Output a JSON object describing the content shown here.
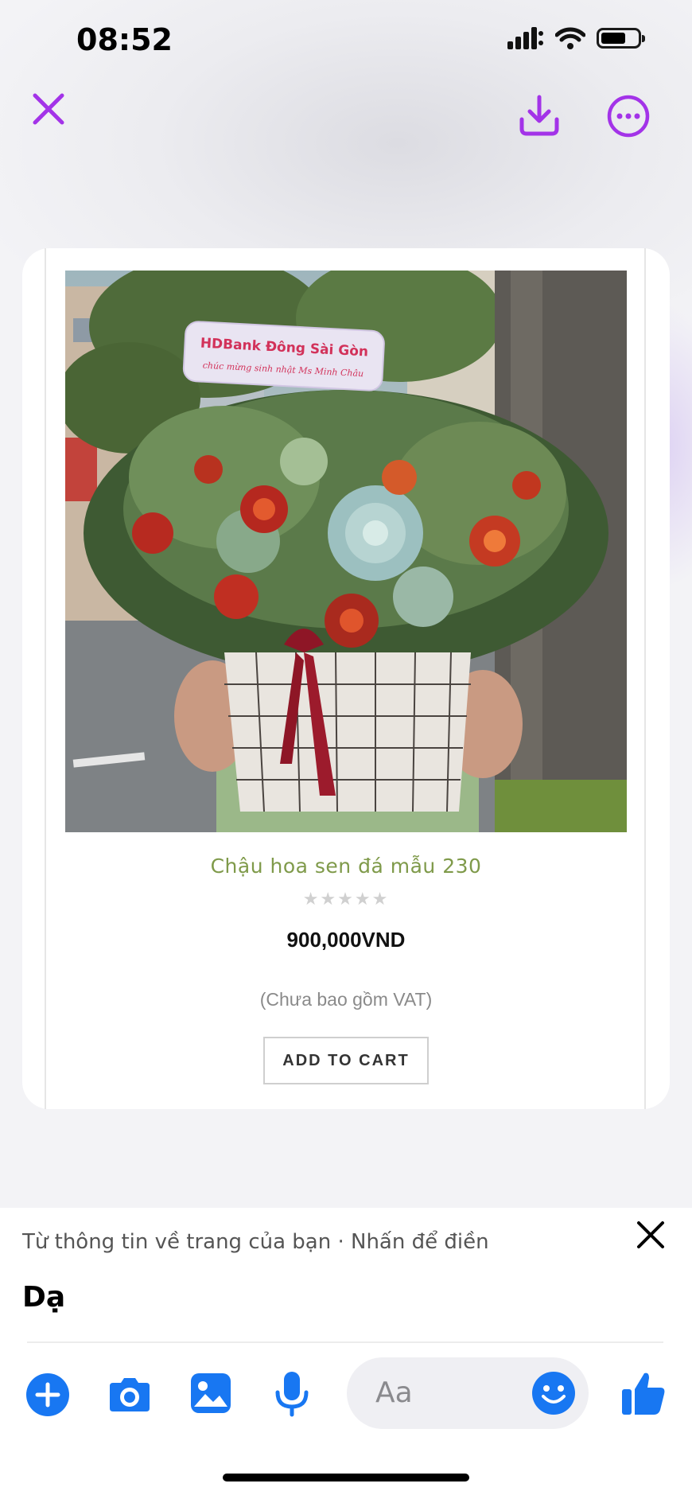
{
  "status_bar": {
    "time": "08:52",
    "icons": [
      "cellular-signal-icon",
      "wifi-icon",
      "battery-icon"
    ]
  },
  "viewer_toolbar": {
    "icons": [
      "close-icon",
      "download-icon",
      "more-options-icon"
    ],
    "accent": "#a333e8"
  },
  "product_card": {
    "name": "Chậu hoa sen đá mẫu 230",
    "rating_stars": 0,
    "stars_display": "★★★★★",
    "price": "900,000VND",
    "vat_note": "(Chưa bao gồm VAT)",
    "cart_button": "ADD TO CART",
    "sign_line1": "HDBank Đông Sài Gòn",
    "sign_line2": "chúc mừng sinh nhật Ms Minh Châu",
    "name_color": "#7f9a4a"
  },
  "message_sheet": {
    "suggestion": "Từ thông tin về trang của bạn · Nhấn để điền",
    "reply_text": "Dạ",
    "composer_placeholder": "Aa",
    "icons": [
      "plus-icon",
      "camera-icon",
      "gallery-icon",
      "microphone-icon",
      "emoji-icon",
      "thumbs-up-icon"
    ],
    "accent": "#1877f2"
  }
}
